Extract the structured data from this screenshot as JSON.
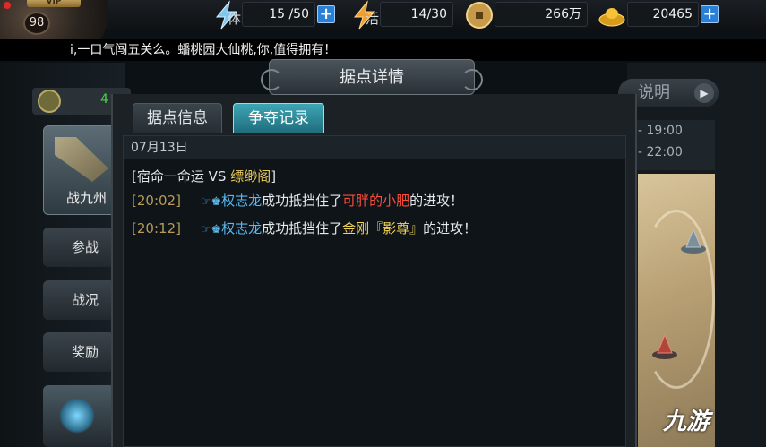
{
  "top_bar": {
    "level": "98",
    "stamina_label": "体",
    "stamina_value": "15 /50",
    "energy_label": "活",
    "energy_value": "14/30",
    "coins_value": "266万",
    "gold_value": "20465",
    "plus_symbol": "+"
  },
  "marquee": {
    "text": "i,一口气闯五关么。蟠桃园大仙桃,你,值得拥有！"
  },
  "background_menu": {
    "count_fragment": "4",
    "zhan_label": "战九州",
    "items": [
      "参战",
      "战况",
      "奖励"
    ],
    "rule_label": "说明",
    "time_slots": [
      "- 19:00",
      "- 22:00"
    ]
  },
  "dialog": {
    "title": "据点详情",
    "tabs": [
      {
        "label": "据点信息",
        "active": false
      },
      {
        "label": "争夺记录",
        "active": true
      }
    ],
    "date": "07月13日",
    "matchup": {
      "open": "[",
      "guild_a": "宿命一命运",
      "vs": " VS ",
      "guild_b": "缥缈阁",
      "close": "]"
    },
    "logs": [
      {
        "time": "[20:02]",
        "attacker": "权志龙",
        "verb": "成功抵挡住了",
        "defender": "可胖的小肥",
        "tail": "的进攻！",
        "defender_color": "#ff4d3a"
      },
      {
        "time": "[20:12]",
        "attacker": "权志龙",
        "verb": "成功抵挡住了",
        "defender": "金刚『影尊』",
        "tail": "的进攻！",
        "defender_color": "#f1d25c"
      }
    ]
  },
  "watermark": "九游",
  "colors": {
    "tab_active": "#3da6b6",
    "attacker_blue": "#5ab8f2",
    "time_gold": "#b59c5b",
    "plus_button": "#2a7fd6"
  }
}
